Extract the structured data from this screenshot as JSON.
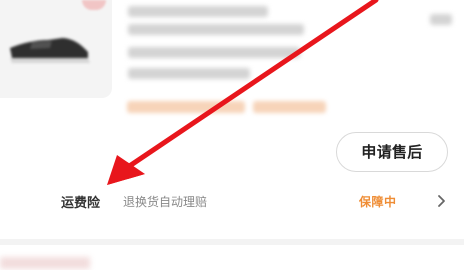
{
  "after_sale": {
    "apply_label": "申请售后"
  },
  "shipping_insurance": {
    "title": "运费险",
    "description": "退换货自动理赔",
    "status": "保障中"
  },
  "icons": {
    "chevron": "chevron-right-icon",
    "arrow": "annotation-arrow-icon"
  },
  "colors": {
    "accent_orange": "#ef8d35",
    "annotation_red": "#e8161c"
  }
}
